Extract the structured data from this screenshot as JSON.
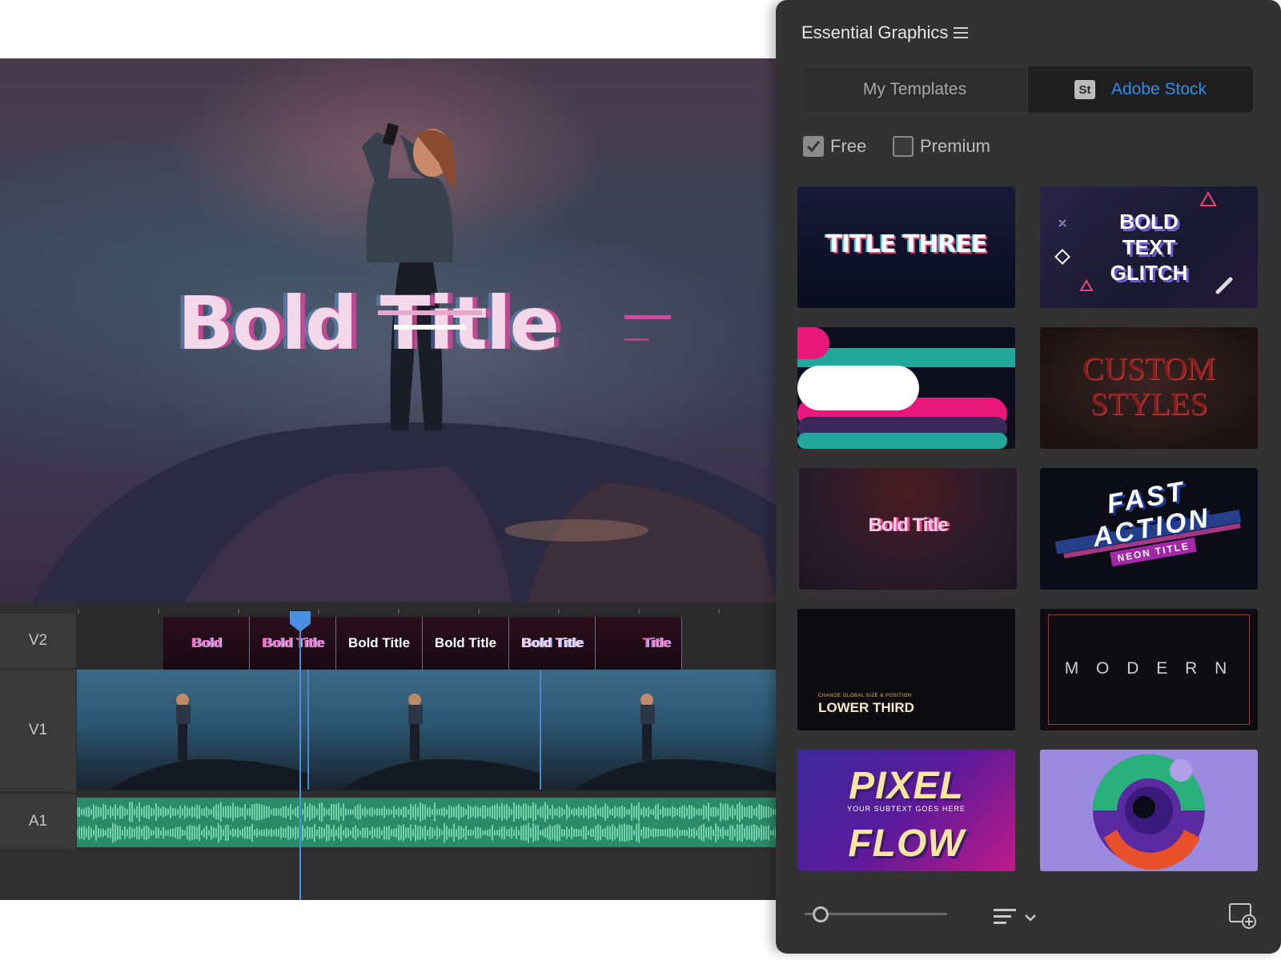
{
  "preview": {
    "title_text": "Bold Title"
  },
  "timeline": {
    "tracks": [
      {
        "label": "V2"
      },
      {
        "label": "V1"
      },
      {
        "label": "A1"
      }
    ],
    "title_clips": [
      {
        "label": "Bold"
      },
      {
        "label": "Bold Title"
      },
      {
        "label": "Bold Title"
      },
      {
        "label": "Bold Title"
      },
      {
        "label": "Bold Title"
      },
      {
        "label": "Title"
      }
    ]
  },
  "panel": {
    "title": "Essential Graphics",
    "tabs": [
      {
        "label": "My Templates"
      },
      {
        "label": "Adobe Stock",
        "badge": "St"
      }
    ],
    "filters": [
      {
        "label": "Free",
        "checked": true
      },
      {
        "label": "Premium",
        "checked": false
      }
    ],
    "templates": [
      {
        "text": "TITLE THREE"
      },
      {
        "lines": [
          "BOLD",
          "TEXT",
          "GLITCH"
        ]
      },
      {
        "text": ""
      },
      {
        "lines": [
          "CUSTOM",
          "STYLES"
        ]
      },
      {
        "text": "Bold Title"
      },
      {
        "lines": [
          "FAST",
          "ACTION"
        ],
        "sub": "NEON TITLE"
      },
      {
        "caption": "CHANGE GLOBAL SIZE & POSITION",
        "text": "LOWER THIRD"
      },
      {
        "text": "M O D E R N"
      },
      {
        "lines": [
          "PIXEL",
          "FLOW"
        ],
        "sub": "YOUR SUBTEXT GOES HERE"
      },
      {
        "text": ""
      }
    ],
    "icons": {
      "menu": "hamburger-menu-icon",
      "sort": "sort-lines-icon",
      "new": "new-item-icon"
    }
  },
  "colors": {
    "accent": "#2d8ceb",
    "playhead": "#4a90e2",
    "audio": "#2a8a6a",
    "panel_bg": "#323232"
  }
}
